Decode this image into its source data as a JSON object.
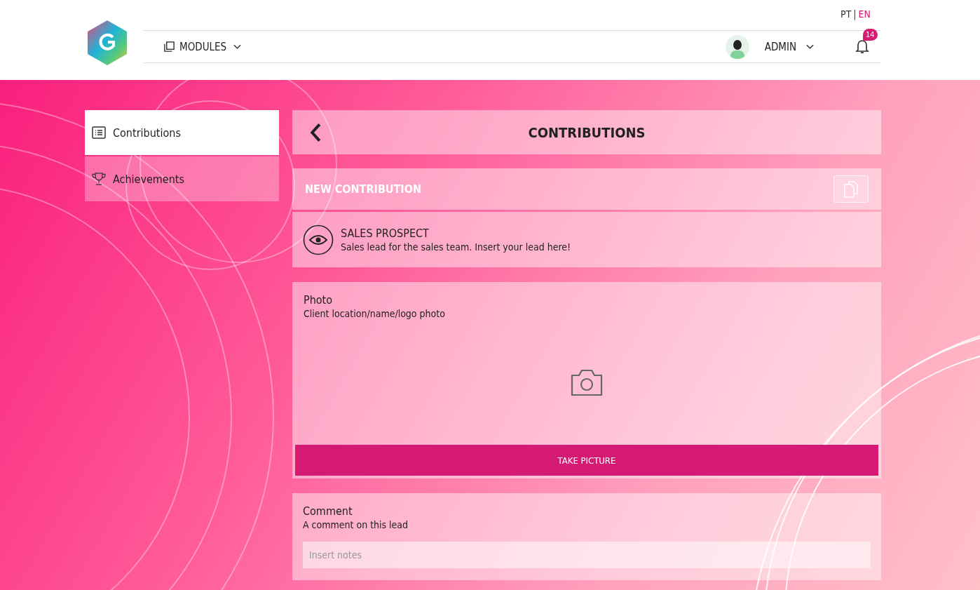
{
  "languages": [
    {
      "code": "PT",
      "selected": false
    },
    {
      "code": "EN",
      "selected": true
    }
  ],
  "language_separator": "|",
  "nav": {
    "modules": "MODULES",
    "user": "ADMIN",
    "notifications": "14"
  },
  "sidebar": {
    "items": [
      {
        "label": "Contributions",
        "kind": "list",
        "selected": true
      },
      {
        "label": "Achievements",
        "kind": "trophy",
        "selected": false
      }
    ]
  },
  "page_title": "CONTRIBUTIONS",
  "new_contribution": {
    "title": "NEW CONTRIBUTION",
    "type_name": "SALES PROSPECT",
    "type_description": "Sales lead for the sales team. Insert your lead here!"
  },
  "photo": {
    "label": "Photo",
    "hint": "Client location/name/logo photo",
    "button": "TAKE PICTURE"
  },
  "comment": {
    "label": "Comment",
    "hint": "A comment on this lead",
    "placeholder": "Insert notes"
  }
}
